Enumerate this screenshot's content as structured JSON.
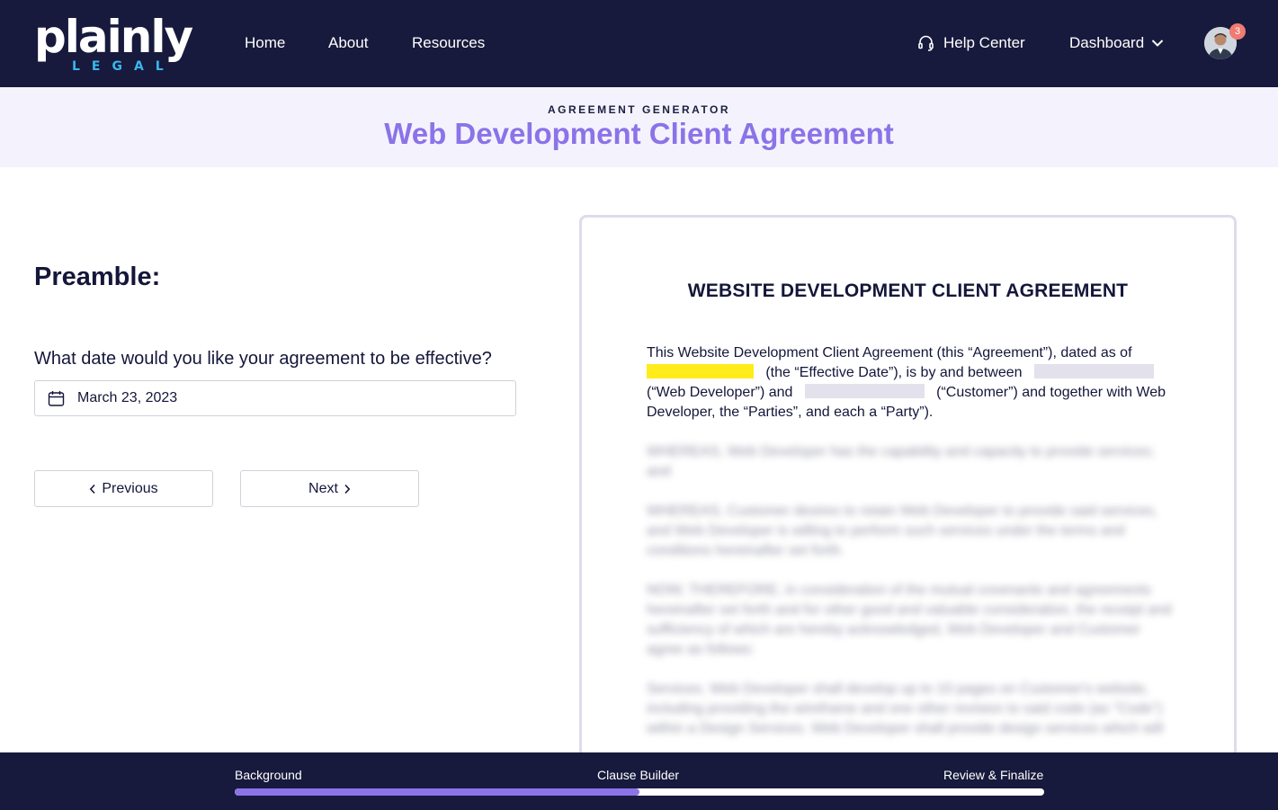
{
  "nav": {
    "logo_main": "plainly",
    "logo_sub": "LEGAL",
    "links": [
      "Home",
      "About",
      "Resources"
    ],
    "help_label": "Help Center",
    "dashboard_label": "Dashboard",
    "notifications": "3",
    "icons": {
      "help": "headset-icon",
      "dashboard": "chevron-down-icon",
      "avatar": "user-avatar"
    }
  },
  "hero": {
    "kicker": "AGREEMENT GENERATOR",
    "title": "Web Development Client Agreement"
  },
  "form": {
    "section": "Preamble:",
    "question": "What date would you like your agreement to be effective?",
    "date_value": "March 23, 2023",
    "date_icon": "calendar-icon",
    "prev_label": "Previous",
    "next_label": "Next"
  },
  "document": {
    "title": "WEBSITE DEVELOPMENT CLIENT AGREEMENT",
    "preamble": {
      "p1": "This Website Development Client Agreement (this “Agreement”), dated as of",
      "p2": "(the “Effective Date”), is by and between",
      "p3": "(“Web Developer”) and",
      "p4": "(“Customer”) and together with Web Developer, the “Parties”, and each a “Party”)."
    },
    "blurred": [
      "WHEREAS, Web Developer has the capability and capacity to provide services; and",
      "WHEREAS, Customer desires to retain Web Developer to provide said services, and Web Developer is willing to perform such services under the terms and conditions hereinafter set forth.",
      "NOW, THEREFORE, in consideration of the mutual covenants and agreements hereinafter set forth and for other good and valuable consideration, the receipt and sufficiency of which are hereby acknowledged, Web Developer and Customer agree as follows:",
      "Services. Web Developer shall develop up to 10 pages on Customer's website, including providing the wireframe and one other revision to said code (as \"Code\") within a Design Services. Web Developer shall provide design services which will"
    ],
    "colors": {
      "highlight": "#ffec1a",
      "blank": "#e2e1ec"
    }
  },
  "progress": {
    "steps": [
      "Background",
      "Clause Builder",
      "Review & Finalize"
    ],
    "fraction": 0.5
  },
  "colors": {
    "navy": "#171a3c",
    "accent": "#8b73e8",
    "logo_sub": "#3ab6ef",
    "badge": "#f07b70"
  }
}
